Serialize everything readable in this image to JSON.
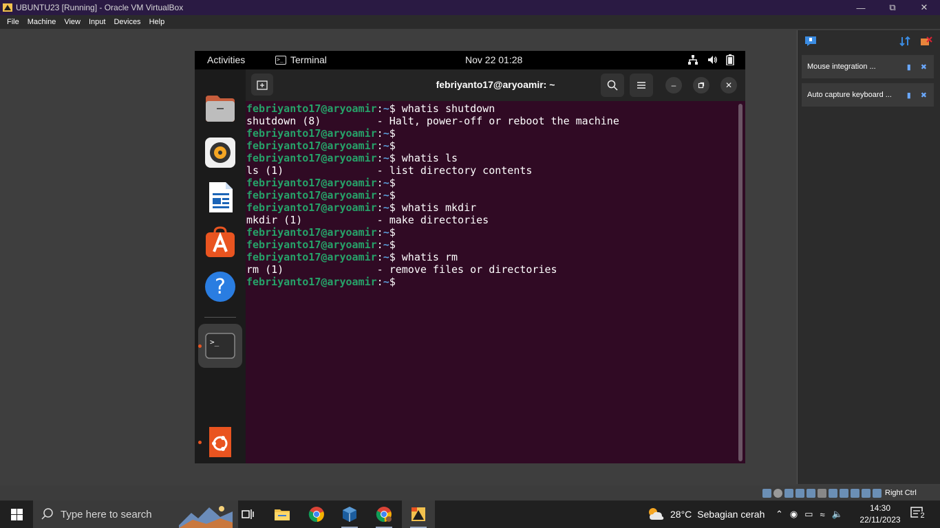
{
  "vbox": {
    "title": "UBUNTU23 [Running] - Oracle VM VirtualBox",
    "menu": [
      "File",
      "Machine",
      "View",
      "Input",
      "Devices",
      "Help"
    ],
    "notices": [
      {
        "text": "Mouse integration ..."
      },
      {
        "text": "Auto capture keyboard ..."
      }
    ],
    "host_key": "Right Ctrl"
  },
  "ubuntu": {
    "activities": "Activities",
    "active_app": "Terminal",
    "clock": "Nov 22  01:28"
  },
  "terminal": {
    "title": "febriyanto17@aryoamir: ~",
    "prompt_user": "febriyanto17@aryoamir",
    "prompt_path": "~",
    "lines": [
      {
        "type": "prompt",
        "cmd": " whatis shutdown"
      },
      {
        "type": "out",
        "text": "shutdown (8)         - Halt, power-off or reboot the machine"
      },
      {
        "type": "prompt",
        "cmd": ""
      },
      {
        "type": "prompt",
        "cmd": ""
      },
      {
        "type": "prompt",
        "cmd": " whatis ls"
      },
      {
        "type": "out",
        "text": "ls (1)               - list directory contents"
      },
      {
        "type": "prompt",
        "cmd": ""
      },
      {
        "type": "prompt",
        "cmd": ""
      },
      {
        "type": "prompt",
        "cmd": " whatis mkdir"
      },
      {
        "type": "out",
        "text": "mkdir (1)            - make directories"
      },
      {
        "type": "prompt",
        "cmd": ""
      },
      {
        "type": "prompt",
        "cmd": ""
      },
      {
        "type": "prompt",
        "cmd": " whatis rm"
      },
      {
        "type": "out",
        "text": "rm (1)               - remove files or directories"
      },
      {
        "type": "prompt",
        "cmd": ""
      }
    ]
  },
  "taskbar": {
    "search_placeholder": "Type here to search",
    "weather_temp": "28°C",
    "weather_desc": "Sebagian cerah",
    "time": "14:30",
    "date": "22/11/2023",
    "notif_count": "2"
  },
  "colors": {
    "ubuntu_orange": "#e95420",
    "terminal_bg": "#300a24",
    "prompt_green": "#26a269",
    "prompt_blue": "#5a9bd6"
  }
}
